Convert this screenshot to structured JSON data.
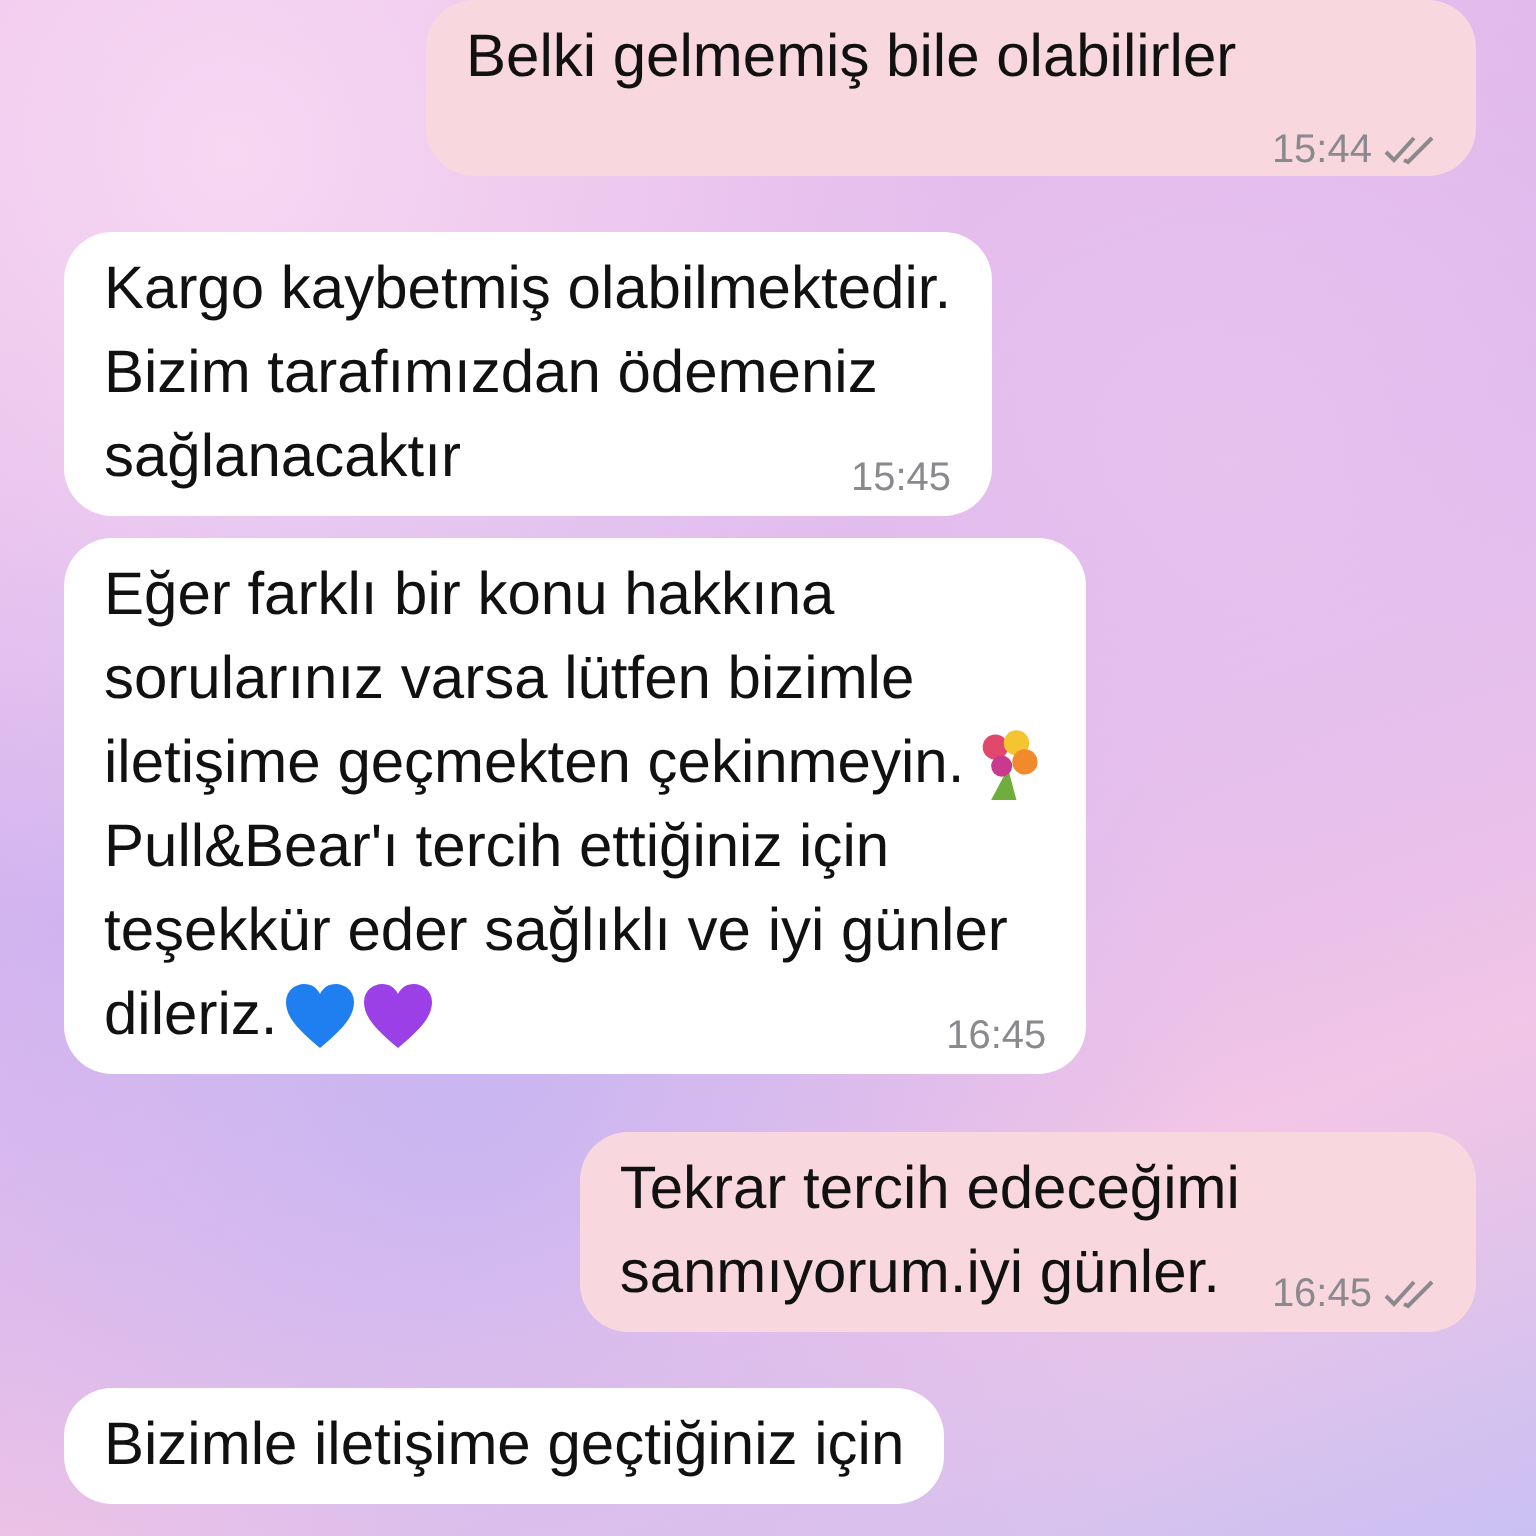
{
  "messages": [
    {
      "kind": "sent",
      "lines": [
        {
          "text": "Belki gelmemiş bile olabilirler"
        }
      ],
      "time": "15:44",
      "read": true
    },
    {
      "kind": "received",
      "lines": [
        {
          "text": "Kargo kaybetmiş olabilmektedir."
        },
        {
          "text": "Bizim tarafımızdan ödemeniz"
        },
        {
          "text": "sağlanacaktır"
        }
      ],
      "time": "15:45"
    },
    {
      "kind": "received",
      "lines": [
        {
          "text": "Eğer farklı bir konu hakkına"
        },
        {
          "text": "sorularınız varsa lütfen bizimle"
        },
        {
          "text": "iletişime geçmekten çekinmeyin.",
          "icons": [
            {
              "kind": "bouquet"
            }
          ]
        },
        {
          "text": "Pull&Bear'ı tercih ettiğiniz için"
        },
        {
          "text": "teşekkür eder sağlıklı ve iyi günler"
        },
        {
          "text": "dileriz.",
          "icons": [
            {
              "kind": "heart",
              "color": "#1f7ef0"
            },
            {
              "kind": "heart",
              "color": "#9b3fe6"
            }
          ]
        }
      ],
      "time": "16:45"
    },
    {
      "kind": "sent",
      "lines": [
        {
          "text": "Tekrar tercih edeceğimi"
        },
        {
          "text": "sanmıyorum.iyi günler."
        }
      ],
      "time": "16:45",
      "read": true
    },
    {
      "kind": "received",
      "lines": [
        {
          "text": "Bizimle iletişime geçtiğiniz için"
        }
      ]
    }
  ]
}
